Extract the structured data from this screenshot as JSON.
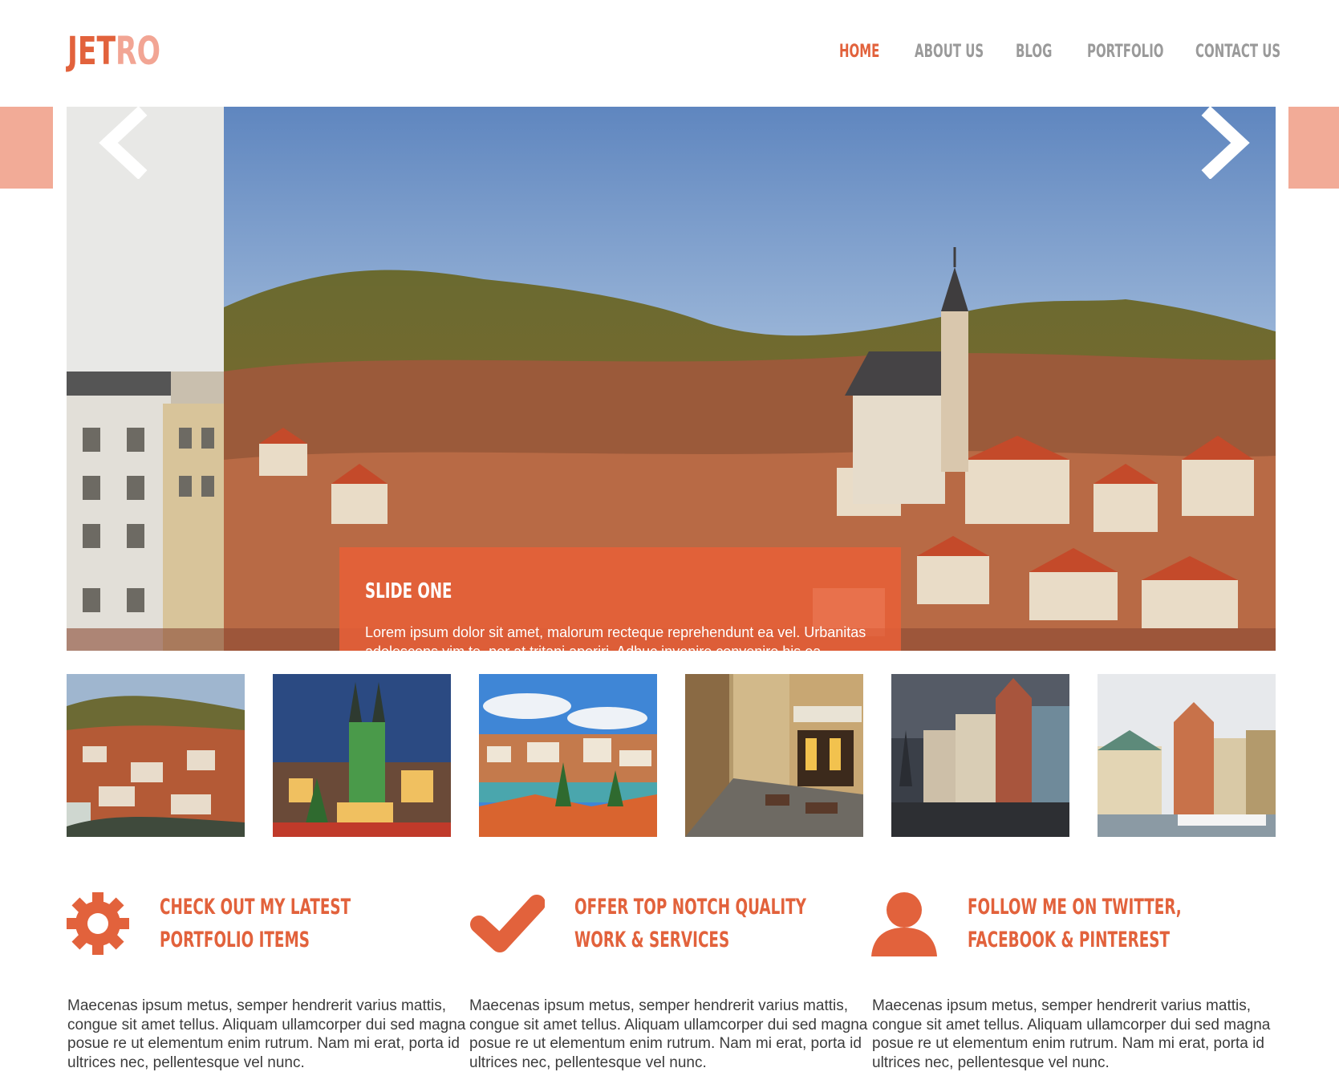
{
  "brand": {
    "logo_part1": "JET",
    "logo_part2": "RO"
  },
  "nav": {
    "items": [
      "HOME",
      "ABOUT US",
      "BLOG",
      "PORTFOLIO",
      "CONTACT US"
    ],
    "active": "HOME"
  },
  "colors": {
    "accent": "#e2623c",
    "accent_light": "#f2a594",
    "nav_text": "#9a9a9a"
  },
  "slider": {
    "caption_title": "SLIDE ONE",
    "caption_text": "Lorem ipsum dolor sit amet, malorum recteque reprehendunt ea vel. Urbanitas adolescens vim te, per at tritani aperiri. Adhuc invenire convenire his ea.",
    "prev_icon": "chevron-left-icon",
    "next_icon": "chevron-right-icon"
  },
  "thumbnails": [
    "town-overview",
    "prague-night",
    "porto-river",
    "cafe-street",
    "old-town-square",
    "stockholm-waterfront"
  ],
  "features": [
    {
      "icon": "gear-icon",
      "title_line1": "CHECK OUT MY LATEST",
      "title_line2": "PORTFOLIO ITEMS",
      "text": "Maecenas ipsum metus, semper hendrerit varius mattis, congue sit amet tellus. Aliquam ullamcorper dui sed magna posue re ut elementum enim rutrum. Nam mi erat, porta id ultrices nec, pellentesque vel nunc."
    },
    {
      "icon": "check-icon",
      "title_line1": "OFFER TOP NOTCH QUALITY",
      "title_line2": "WORK & SERVICES",
      "text": "Maecenas ipsum metus, semper hendrerit varius mattis, congue sit amet tellus. Aliquam ullamcorper dui sed magna posue re ut elementum enim rutrum. Nam mi erat, porta id ultrices nec, pellentesque vel nunc."
    },
    {
      "icon": "user-icon",
      "title_line1": "FOLLOW ME ON TWITTER,",
      "title_line2": "FACEBOOK & PINTEREST",
      "text": "Maecenas ipsum metus, semper hendrerit varius mattis, congue sit amet tellus. Aliquam ullamcorper dui sed magna posue re ut elementum enim rutrum. Nam mi erat, porta id ultrices nec, pellentesque vel nunc."
    }
  ]
}
